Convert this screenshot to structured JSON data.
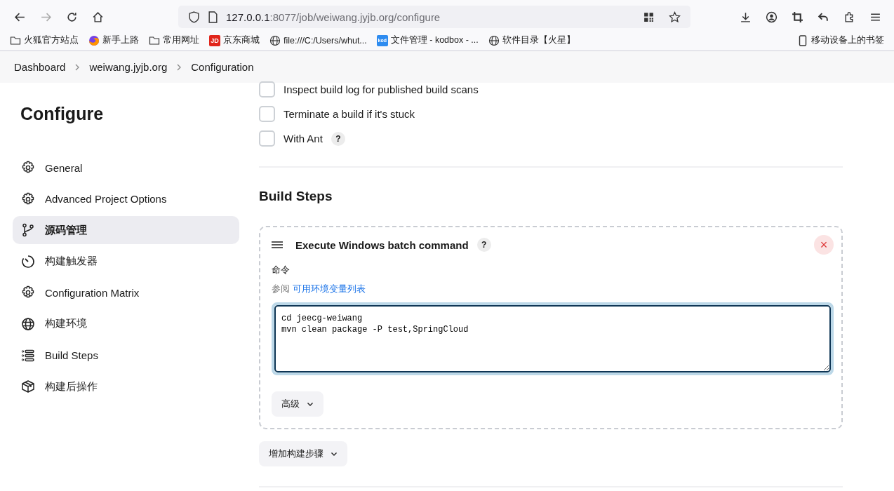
{
  "browser": {
    "url_host": "127.0.0.1",
    "url_path": ":8077/job/weiwang.jyjb.org/configure",
    "bookmarks": [
      {
        "kind": "folder",
        "label": "火狐官方站点"
      },
      {
        "kind": "firefox",
        "label": "新手上路"
      },
      {
        "kind": "folder",
        "label": "常用网址"
      },
      {
        "kind": "jd",
        "logo": "JD",
        "label": "京东商城"
      },
      {
        "kind": "globe",
        "label": "file:///C:/Users/whut..."
      },
      {
        "kind": "kod",
        "logo": "kod",
        "label": "文件管理 - kodbox - ..."
      },
      {
        "kind": "globe",
        "label": "软件目录【火星】"
      }
    ],
    "mobile_bookmarks": "移动设备上的书签"
  },
  "breadcrumbs": [
    "Dashboard",
    "weiwang.jyjb.org",
    "Configuration"
  ],
  "sidebar": {
    "title": "Configure",
    "items": [
      {
        "kind": "gear",
        "label": "General",
        "selected": false
      },
      {
        "kind": "gear",
        "label": "Advanced Project Options",
        "selected": false
      },
      {
        "kind": "branch",
        "label": "源码管理",
        "selected": true
      },
      {
        "kind": "timer",
        "label": "构建触发器",
        "selected": false
      },
      {
        "kind": "gear",
        "label": "Configuration Matrix",
        "selected": false
      },
      {
        "kind": "globe",
        "label": "构建环境",
        "selected": false
      },
      {
        "kind": "list",
        "label": "Build Steps",
        "selected": false
      },
      {
        "kind": "package",
        "label": "构建后操作",
        "selected": false
      }
    ]
  },
  "options": [
    {
      "label": "Inspect build log for published build scans",
      "checked": false,
      "help": false
    },
    {
      "label": "Terminate a build if it's stuck",
      "checked": false,
      "help": false
    },
    {
      "label": "With Ant",
      "checked": false,
      "help": true
    }
  ],
  "help_mark": "?",
  "section_title": "Build Steps",
  "step": {
    "title": "Execute Windows batch command",
    "close": "×",
    "field_label": "命令",
    "hint_prefix": "参阅",
    "hint_link": "可用环境变量列表",
    "command": "cd jeecg-weiwang\nmvn clean package -P test,SpringCloud",
    "advanced": "高级"
  },
  "add_step": "增加构建步骤"
}
